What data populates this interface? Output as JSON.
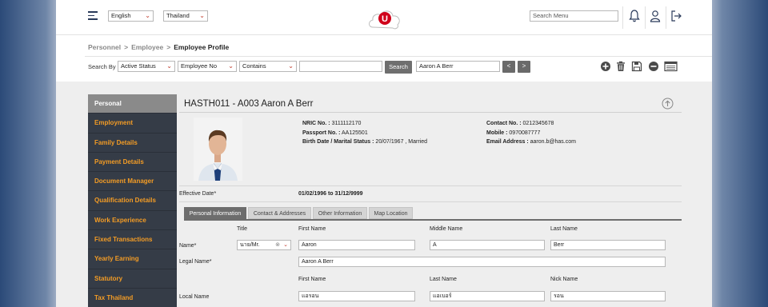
{
  "topbar": {
    "language": "English",
    "country": "Thailand",
    "search_placeholder": "Search Menu",
    "logo_letter": "U"
  },
  "breadcrumb": {
    "items": [
      "Personnel",
      "Employee"
    ],
    "current": "Employee Profile"
  },
  "search": {
    "label": "Search By",
    "status": "Active Status",
    "field": "Employee No",
    "operator": "Contains",
    "value": "",
    "button": "Search",
    "result": "Aaron A Berr",
    "prev": "<",
    "next": ">"
  },
  "sidebar": {
    "items": [
      {
        "label": "Personal"
      },
      {
        "label": "Employment"
      },
      {
        "label": "Family Details"
      },
      {
        "label": "Payment Details"
      },
      {
        "label": "Document Manager"
      },
      {
        "label": "Qualification Details"
      },
      {
        "label": "Work Experience"
      },
      {
        "label": "Fixed Transactions"
      },
      {
        "label": "Yearly Earning"
      },
      {
        "label": "Statutory"
      },
      {
        "label": "Tax Thailand"
      }
    ]
  },
  "employee": {
    "title": "HASTH011 - A003 Aaron A Berr",
    "nric_label": "NRIC No. :",
    "nric": "3111112170",
    "passport_label": "Passport No. :",
    "passport": "AA125501",
    "birth_label": "Birth Date / Marital Status :",
    "birth": "20/07/1967 , Married",
    "contact_label": "Contact No. :",
    "contact": "0212345678",
    "mobile_label": "Mobile :",
    "mobile": "0970087777",
    "email_label": "Email Address :",
    "email": "aaron.b@has.com",
    "effective_label": "Effective Date*",
    "effective": "01/02/1996 to 31/12/9999"
  },
  "tabs": [
    "Personal Information",
    "Contact & Addresses",
    "Other Information",
    "Map Location"
  ],
  "form": {
    "title_label": "Title",
    "first_name_label": "First Name",
    "middle_name_label": "Middle Name",
    "last_name_label": "Last Name",
    "name_label": "Name*",
    "title_value": "นาย/Mr.",
    "first_name": "Aaron",
    "middle_name": "A",
    "last_name": "Berr",
    "legal_name_label": "Legal Name*",
    "legal_name": "Aaron A Berr",
    "local_first_label": "First Name",
    "local_last_label": "Last Name",
    "nick_label": "Nick Name",
    "local_name_label": "Local Name",
    "local_first": "แอรอน",
    "local_last": "แอเบอร์",
    "nick": "รอน"
  },
  "colors": {
    "sidebar_bg": "#353c47",
    "sidebar_text": "#f39c25",
    "sidebar_active": "#8a8a8a",
    "logo_red": "#d0021b"
  }
}
